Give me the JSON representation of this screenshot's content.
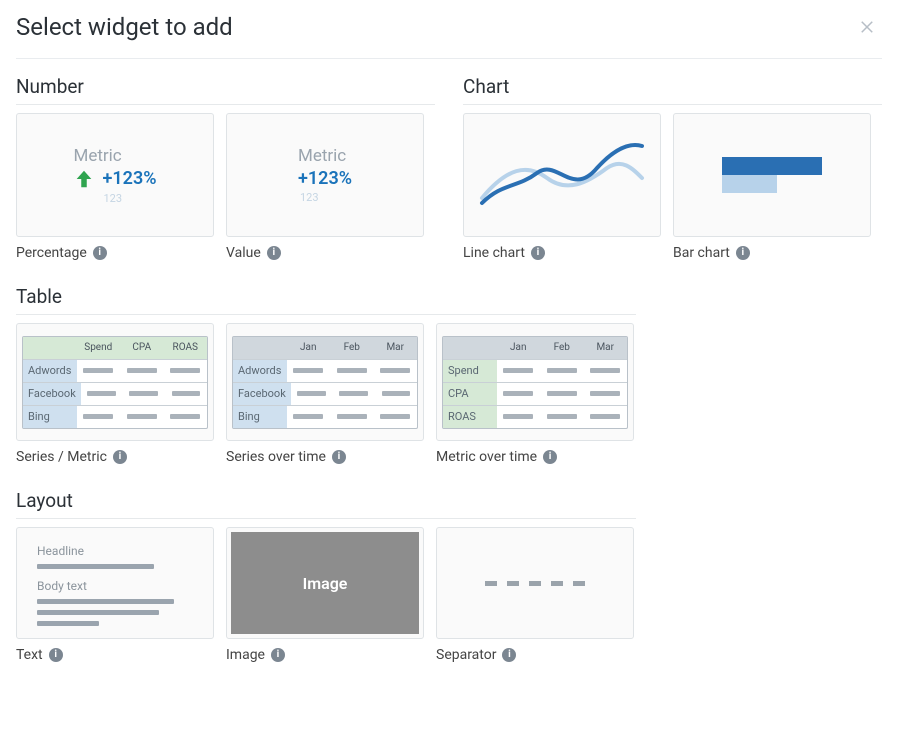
{
  "title": "Select widget to add",
  "sections": {
    "number": {
      "title": "Number",
      "percentage": {
        "label": "Percentage",
        "metric_label": "Metric",
        "value": "+123%",
        "sub": "123"
      },
      "value": {
        "label": "Value",
        "metric_label": "Metric",
        "value": "+123%",
        "sub": "123"
      }
    },
    "chart": {
      "title": "Chart",
      "line": {
        "label": "Line chart"
      },
      "bar": {
        "label": "Bar chart"
      }
    },
    "table": {
      "title": "Table",
      "series_metric": {
        "label": "Series / Metric",
        "cols": [
          "Spend",
          "CPA",
          "ROAS"
        ],
        "rows": [
          "Adwords",
          "Facebook",
          "Bing"
        ]
      },
      "series_time": {
        "label": "Series over time",
        "cols": [
          "Jan",
          "Feb",
          "Mar"
        ],
        "rows": [
          "Adwords",
          "Facebook",
          "Bing"
        ]
      },
      "metric_time": {
        "label": "Metric over time",
        "cols": [
          "Jan",
          "Feb",
          "Mar"
        ],
        "rows": [
          "Spend",
          "CPA",
          "ROAS"
        ]
      }
    },
    "layout": {
      "title": "Layout",
      "text": {
        "label": "Text",
        "headline": "Headline",
        "body": "Body text"
      },
      "image": {
        "label": "Image",
        "placeholder": "Image"
      },
      "separator": {
        "label": "Separator"
      }
    }
  }
}
